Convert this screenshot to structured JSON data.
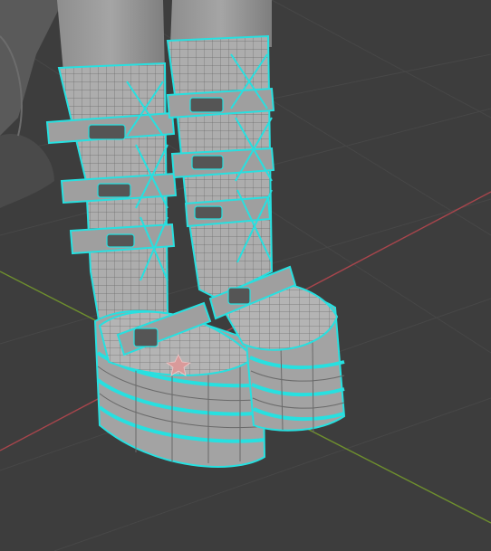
{
  "viewport": {
    "background": "#3d3d3d",
    "grid_color": "#474747",
    "x_axis_color": "#a8454c",
    "y_axis_color": "#6e8f2e"
  },
  "model": {
    "mesh_color": "#a9a9a9",
    "selection_color": "#27e0e0",
    "wire_color": "#5a5a5a",
    "object": "platform-boots",
    "mode": "edit-mode-selection"
  }
}
